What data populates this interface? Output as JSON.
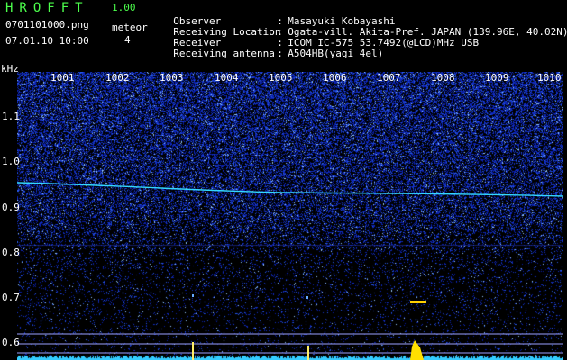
{
  "header": {
    "app_title": "HROFFT",
    "version": "1.00",
    "file_name": "0701101000.png",
    "timestamp": "07.01.10 10:00",
    "meteor_label": "meteor",
    "meteor_count": "4"
  },
  "info": [
    {
      "label": "Observer",
      "value": "Masayuki Kobayashi"
    },
    {
      "label": "Receiving Location",
      "value": "Ogata-vill. Akita-Pref. JAPAN (139.96E, 40.02N)"
    },
    {
      "label": "Receiver",
      "value": "ICOM IC-575 53.7492(@LCD)MHz USB"
    },
    {
      "label": "Receiving antenna",
      "value": "A504HB(yagi 4el)"
    }
  ],
  "axes": {
    "y_unit": "kHz",
    "y_ticks": [
      "1.1",
      "1.0",
      "0.9",
      "0.8",
      "0.7",
      "0.6"
    ],
    "x_ticks": [
      "1001",
      "1002",
      "1003",
      "1004",
      "1005",
      "1006",
      "1007",
      "1008",
      "1009",
      "1010"
    ]
  },
  "colors": {
    "background": "#000000",
    "title_green": "#4cff4c",
    "noise_blue": "#1a2fd0",
    "signal_cyan": "#33d6ff",
    "meteor_yellow": "#ffe000"
  }
}
